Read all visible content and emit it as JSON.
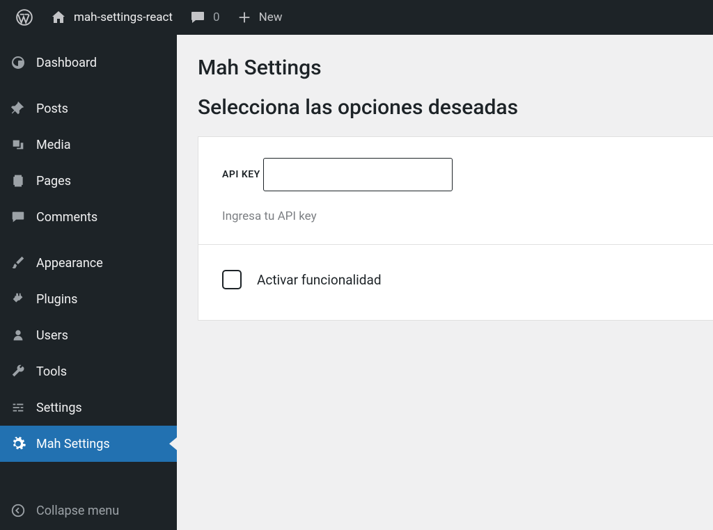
{
  "admin_bar": {
    "site_name": "mah-settings-react",
    "comments_count": "0",
    "new_label": "New"
  },
  "sidebar": {
    "items": [
      {
        "label": "Dashboard",
        "icon": "dashboard-icon"
      },
      {
        "label": "Posts",
        "icon": "pin-icon"
      },
      {
        "label": "Media",
        "icon": "media-icon"
      },
      {
        "label": "Pages",
        "icon": "pages-icon"
      },
      {
        "label": "Comments",
        "icon": "comments-icon"
      },
      {
        "label": "Appearance",
        "icon": "brush-icon"
      },
      {
        "label": "Plugins",
        "icon": "plug-icon"
      },
      {
        "label": "Users",
        "icon": "user-icon"
      },
      {
        "label": "Tools",
        "icon": "wrench-icon"
      },
      {
        "label": "Settings",
        "icon": "sliders-icon"
      },
      {
        "label": "Mah Settings",
        "icon": "gear-icon"
      }
    ],
    "collapse_label": "Collapse menu"
  },
  "page": {
    "title": "Mah Settings",
    "subtitle": "Selecciona las opciones deseadas",
    "api_key": {
      "label": "API KEY",
      "value": "",
      "help": "Ingresa tu API key"
    },
    "toggle": {
      "label": "Activar funcionalidad",
      "checked": false
    }
  }
}
